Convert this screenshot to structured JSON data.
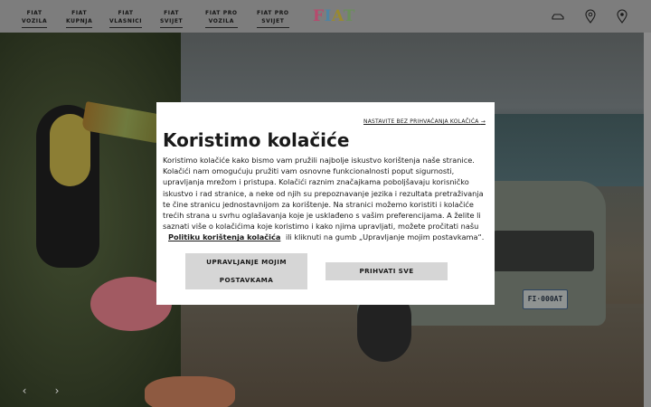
{
  "header": {
    "nav": [
      {
        "label": "FIAT\nVOZILA"
      },
      {
        "label": "FIAT\nKUPNJA"
      },
      {
        "label": "FIAT\nVLASNICI"
      },
      {
        "label": "FIAT\nSVIJET"
      },
      {
        "label": "FIAT PRO\nVOZILA"
      },
      {
        "label": "FIAT PRO\nSVIJET"
      }
    ],
    "logo_letters": [
      "F",
      "I",
      "A",
      "T"
    ],
    "icons": [
      "car-icon",
      "location-pin-icon",
      "dealer-pin-icon"
    ]
  },
  "hero": {
    "plate_text": "FI·000AT",
    "prev_label": "‹",
    "next_label": "›"
  },
  "cookie_modal": {
    "skip_link": "NASTAVITE BEZ PRIHVAĆANJA KOLAČIĆA",
    "skip_arrow": "→",
    "title": "Koristimo kolačiće",
    "body": "Koristimo kolačiće kako bismo vam pružili najbolje iskustvo korištenja naše stranice. Kolačići nam omogućuju pružiti vam osnovne funkcionalnosti poput sigurnosti, upravljanja mrežom i pristupa. Kolačići raznim značajkama poboljšavaju korisničko iskustvo i rad stranice, a neke od njih su prepoznavanje jezika i rezultata pretraživanja te čine stranicu jednostavnijom za korištenje. Na stranici možemo koristiti i kolačiće trećih strana u svrhu oglašavanja koje je usklađeno s vašim preferencijama. A želite li saznati više o kolačićima koje koristimo i kako njima upravljati, možete pročitati našu",
    "policy_link": "Politiku korištenja kolačića",
    "body_end": "ili kliknuti na gumb „Upravljanje mojim postavkama“.",
    "manage_button": "UPRAVLJANJE MOJIM POSTAVKAMA",
    "accept_button": "PRIHVATI SVE"
  },
  "colors": {
    "overlay": "#6d6d6d",
    "modal_bg": "#ffffff",
    "button_bg": "#d6d6d6"
  }
}
